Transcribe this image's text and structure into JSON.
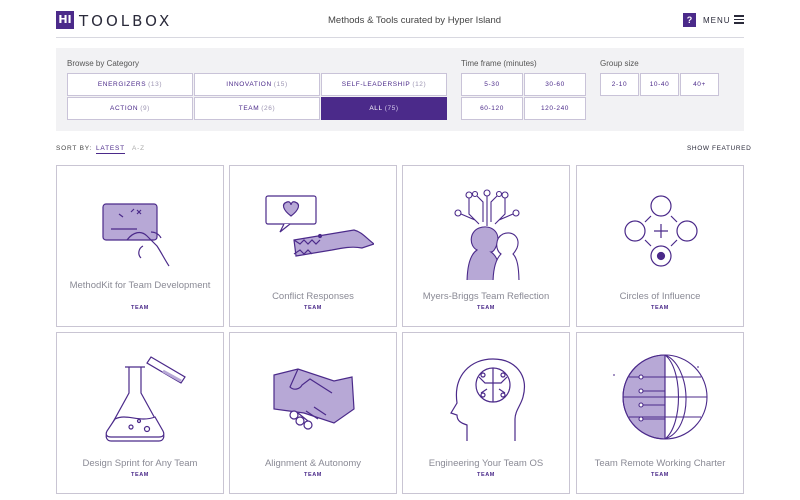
{
  "header": {
    "logo_mark": "HI",
    "logo_text": "TOOLBOX",
    "tagline": "Methods & Tools curated by Hyper Island",
    "help": "?",
    "menu_label": "MENU"
  },
  "filters": {
    "category_label": "Browse by Category",
    "categories": [
      {
        "label": "ENERGIZERS",
        "count": "(13)",
        "active": false
      },
      {
        "label": "INNOVATION",
        "count": "(15)",
        "active": false
      },
      {
        "label": "SELF-LEADERSHIP",
        "count": "(12)",
        "active": false
      },
      {
        "label": "ACTION",
        "count": "(9)",
        "active": false
      },
      {
        "label": "TEAM",
        "count": "(26)",
        "active": false
      },
      {
        "label": "ALL",
        "count": "(75)",
        "active": true
      }
    ],
    "time_label": "Time frame (minutes)",
    "times": [
      "5-30",
      "30-60",
      "60-120",
      "120-240"
    ],
    "group_label": "Group size",
    "groups": [
      "2-10",
      "10-40",
      "40+"
    ]
  },
  "sort": {
    "label": "SORT BY:",
    "options": [
      "LATEST",
      "A-Z"
    ],
    "selected": "LATEST",
    "show_featured": "SHOW FEATURED"
  },
  "cards": [
    {
      "title": "MethodKit for Team Development",
      "tag": "TEAM",
      "icon": "hand-card-icon"
    },
    {
      "title": "Conflict Responses",
      "tag": "TEAM",
      "icon": "crocodile-heart-icon"
    },
    {
      "title": "Myers-Briggs Team Reflection",
      "tag": "TEAM",
      "icon": "two-heads-circuit-icon"
    },
    {
      "title": "Circles of Influence",
      "tag": "TEAM",
      "icon": "circles-diagram-icon"
    },
    {
      "title": "Design Sprint for Any Team",
      "tag": "TEAM",
      "icon": "flask-icon"
    },
    {
      "title": "Alignment & Autonomy",
      "tag": "TEAM",
      "icon": "handshake-icon"
    },
    {
      "title": "Engineering Your Team OS",
      "tag": "TEAM",
      "icon": "head-brain-circuit-icon"
    },
    {
      "title": "Team Remote Working Charter",
      "tag": "TEAM",
      "icon": "globe-circuit-icon"
    }
  ],
  "colors": {
    "accent": "#4b2a8a",
    "accent_light": "#b7a8d6",
    "panel_bg": "#f2f2f4"
  }
}
